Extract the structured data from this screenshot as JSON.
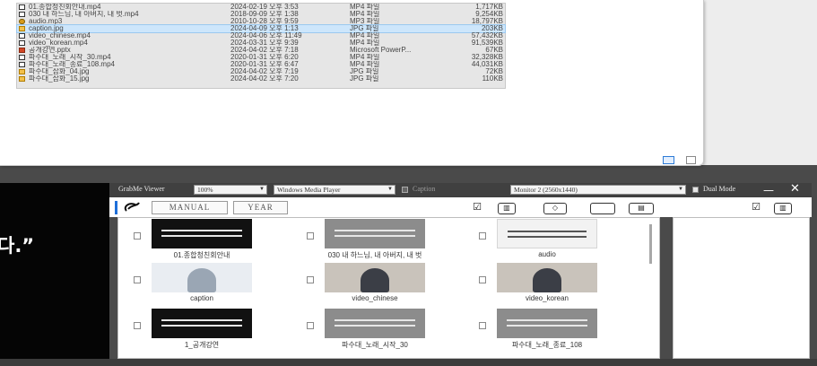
{
  "explorer": {
    "files": [
      {
        "name": "01.종합청친회안내.mp4",
        "date": "2024-02-19 오후 3:53",
        "type": "MP4 파일",
        "size": "1,717KB",
        "icon": "mp4"
      },
      {
        "name": "030 내 하느님, 내 아버지, 내 벗.mp4",
        "date": "2018-09-09 오후 1:38",
        "type": "MP4 파일",
        "size": "9,254KB",
        "icon": "mp4"
      },
      {
        "name": "audio.mp3",
        "date": "2010-10-28 오후 9:59",
        "type": "MP3 파일",
        "size": "18,797KB",
        "icon": "mp3"
      },
      {
        "name": "caption.jpg",
        "date": "2024-04-09 오후 1:13",
        "type": "JPG 파일",
        "size": "203KB",
        "icon": "jpg",
        "selected": true
      },
      {
        "name": "video_chinese.mp4",
        "date": "2024-04-06 오후 11:49",
        "type": "MP4 파일",
        "size": "57,432KB",
        "icon": "mp4"
      },
      {
        "name": "video_korean.mp4",
        "date": "2024-03-31 오후 9:39",
        "type": "MP4 파일",
        "size": "91,539KB",
        "icon": "mp4"
      },
      {
        "name": "공개강연.pptx",
        "date": "2024-04-02 오후 7:18",
        "type": "Microsoft PowerP...",
        "size": "67KB",
        "icon": "pptx"
      },
      {
        "name": "파수대_노래_시작_30.mp4",
        "date": "2020-01-31 오후 6:20",
        "type": "MP4 파일",
        "size": "32,328KB",
        "icon": "mp4"
      },
      {
        "name": "파수대_노래_종료_108.mp4",
        "date": "2020-01-31 오후 6:47",
        "type": "MP4 파일",
        "size": "44,031KB",
        "icon": "mp4"
      },
      {
        "name": "파수대_삽화_04.jpg",
        "date": "2024-04-02 오후 7:19",
        "type": "JPG 파일",
        "size": "72KB",
        "icon": "jpg"
      },
      {
        "name": "파수대_삽화_15.jpg",
        "date": "2024-04-02 오후 7:20",
        "type": "JPG 파일",
        "size": "110KB",
        "icon": "jpg"
      }
    ]
  },
  "video": {
    "text": "다.”"
  },
  "viewer": {
    "title": "GrabMe Viewer",
    "zoom": "100%",
    "player": "Windows Media Player",
    "caption_label": "Caption",
    "monitor": "Monitor 2 (2560x1440)",
    "dual_mode_label": "Dual Mode",
    "tabs": {
      "manual": "MANUAL",
      "year": "YEAR"
    },
    "thumbs": [
      {
        "caption": "01.종합청친회안내",
        "style": "dark"
      },
      {
        "caption": "030 내 하느님, 내 아버지, 내 벗",
        "style": "gray"
      },
      {
        "caption": "audio",
        "style": "light"
      },
      {
        "caption": "caption",
        "style": "web"
      },
      {
        "caption": "video_chinese",
        "style": "office"
      },
      {
        "caption": "video_korean",
        "style": "office"
      },
      {
        "caption": "1_공개강연",
        "style": "dark"
      },
      {
        "caption": "파수대_노래_시작_30",
        "style": "gray"
      },
      {
        "caption": "파수대_노래_종료_108",
        "style": "gray"
      }
    ]
  },
  "colors": {
    "accent": "#1e6fd9",
    "selection": "#cde6fb",
    "chrome": "#4a4a4a"
  }
}
